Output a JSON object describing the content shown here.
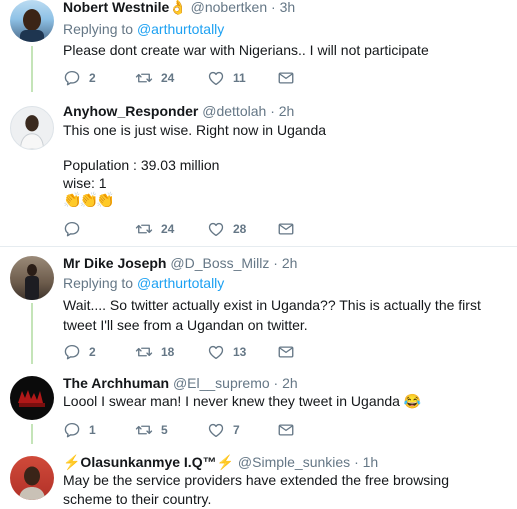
{
  "tweets": [
    {
      "name": "Nobert Westnile",
      "name_emoji": "👌",
      "handle": "@nobertken",
      "time": "3h",
      "replying_prefix": "Replying to ",
      "replying_to": "@arthurtotally",
      "text": "Please dont create war with Nigerians.. I will not participate",
      "replies": "2",
      "retweets": "24",
      "likes": "11"
    },
    {
      "name": "Anyhow_Responder",
      "handle": "@dettolah",
      "time": "2h",
      "text_line1": "This one is just wise. Right now in Uganda",
      "text_line2": "Population : 39.03 million",
      "text_line3": "wise: 1",
      "text_line4": "👏👏👏",
      "replies": "",
      "retweets": "24",
      "likes": "28"
    },
    {
      "name": "Mr Dike Joseph",
      "handle": "@D_Boss_Millz",
      "time": "2h",
      "replying_prefix": "Replying to ",
      "replying_to": "@arthurtotally",
      "text": "Wait.... So twitter actually exist in Uganda??  This is actually the first tweet I'll see from a Ugandan on twitter.",
      "replies": "2",
      "retweets": "18",
      "likes": "13"
    },
    {
      "name": "The Archhuman",
      "handle": "@El__supremo",
      "time": "2h",
      "text": "Loool I swear man! I never knew they tweet in Uganda 😂",
      "replies": "1",
      "retweets": "5",
      "likes": "7"
    },
    {
      "name": "⚡Olasunkanmye I.Q™⚡",
      "handle": "@Simple_sunkies",
      "time": "1h",
      "text": "May be the service providers have extended the free browsing scheme to their country."
    }
  ],
  "dot": "·",
  "colors": {
    "link": "#1da1f2",
    "muted": "#657786",
    "thread_line": "#c4e4b8",
    "divider": "#e6ecf0"
  },
  "icons": [
    "reply-icon",
    "retweet-icon",
    "like-icon",
    "message-icon"
  ]
}
